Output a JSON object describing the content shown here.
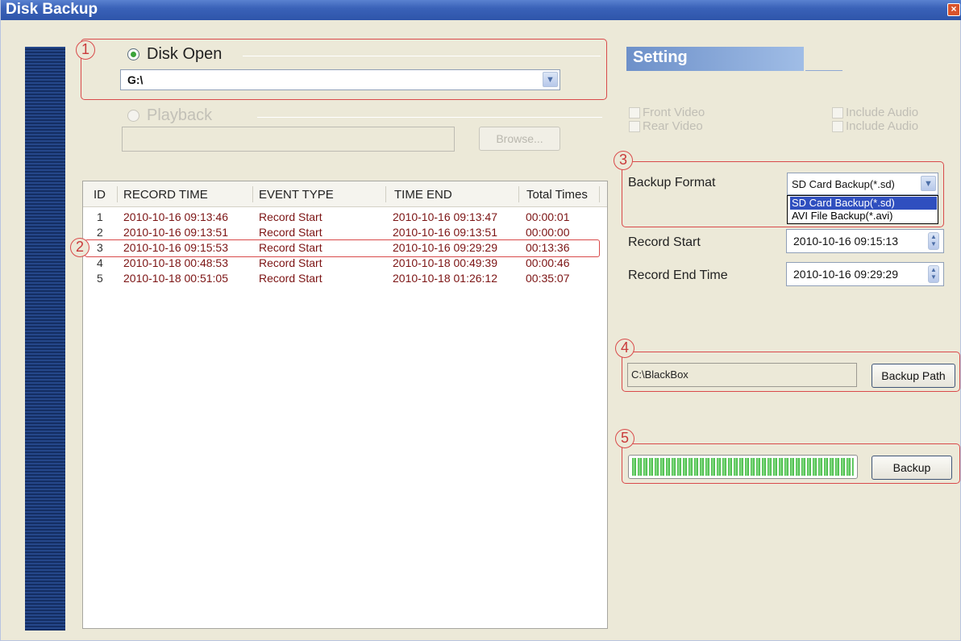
{
  "window": {
    "title": "Disk Backup"
  },
  "callouts": [
    "1",
    "2",
    "3",
    "4",
    "5"
  ],
  "disk_open": {
    "label": "Disk Open",
    "path": "G:\\"
  },
  "playback": {
    "label": "Playback",
    "browse_label": "Browse..."
  },
  "records": {
    "columns": [
      "ID",
      "RECORD TIME",
      "EVENT TYPE",
      "TIME END",
      "Total Times"
    ],
    "rows": [
      [
        "1",
        "2010-10-16 09:13:46",
        "Record Start",
        "2010-10-16 09:13:47",
        "00:00:01"
      ],
      [
        "2",
        "2010-10-16 09:13:51",
        "Record Start",
        "2010-10-16 09:13:51",
        "00:00:00"
      ],
      [
        "3",
        "2010-10-16 09:15:53",
        "Record Start",
        "2010-10-16 09:29:29",
        "00:13:36"
      ],
      [
        "4",
        "2010-10-18 00:48:53",
        "Record Start",
        "2010-10-18 00:49:39",
        "00:00:46"
      ],
      [
        "5",
        "2010-10-18 00:51:05",
        "Record Start",
        "2010-10-18 01:26:12",
        "00:35:07"
      ]
    ]
  },
  "setting": {
    "header": "Setting",
    "front_video": "Front Video",
    "rear_video": "Rear Video",
    "include_audio": "Include Audio",
    "backup_format_label": "Backup Format",
    "backup_format_value": "SD Card Backup(*.sd)",
    "backup_format_options": [
      "SD Card Backup(*.sd)",
      "AVI File Backup(*.avi)"
    ],
    "record_start_label": "Record Start",
    "record_start_value": "2010-10-16 09:15:13",
    "record_end_label": "Record End Time",
    "record_end_value": "2010-10-16 09:29:29"
  },
  "backup_path": {
    "value": "C:\\BlackBox",
    "button_label": "Backup Path"
  },
  "backup": {
    "button_label": "Backup",
    "progress_percent": 100
  }
}
